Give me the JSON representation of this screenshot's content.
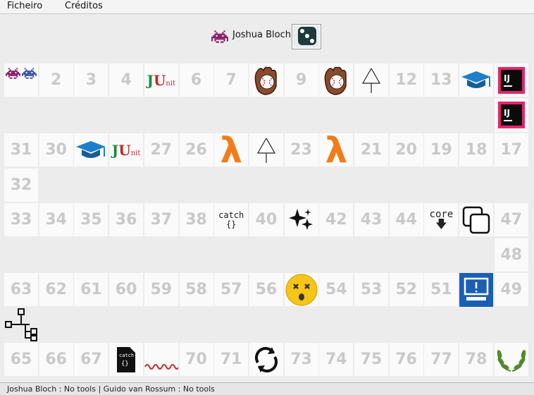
{
  "menu": {
    "file": "Ficheiro",
    "credits": "Créditos"
  },
  "player": {
    "name": "Joshua Bloch",
    "icon": "space-invader-icon",
    "die_icon": "die-icon"
  },
  "status": "Joshua Bloch : No tools | Guido van Rossum : No tools",
  "colors": {
    "invader": "#8b1f6a",
    "lambda": "#f27c17",
    "monitor": "#1a5fb4",
    "emoji": "#f5c518",
    "laurel": "#4f8a2a",
    "wave": "#cc2a2a"
  },
  "cells": [
    {
      "id": "c1",
      "label": "",
      "icon": "two-invaders-icon"
    },
    {
      "id": "c2",
      "label": "2"
    },
    {
      "id": "c3",
      "label": "3"
    },
    {
      "id": "c4",
      "label": "4"
    },
    {
      "id": "c5",
      "label": "",
      "icon": "junit-icon",
      "text": "JU",
      "sub": "nit"
    },
    {
      "id": "c6",
      "label": "6"
    },
    {
      "id": "c7",
      "label": "7"
    },
    {
      "id": "c8",
      "label": "",
      "icon": "baseball-glove-icon"
    },
    {
      "id": "c9",
      "label": "9"
    },
    {
      "id": "c10",
      "label": "",
      "icon": "baseball-glove-icon"
    },
    {
      "id": "c11",
      "label": "",
      "icon": "arrow-up-icon"
    },
    {
      "id": "c12",
      "label": "12"
    },
    {
      "id": "c13",
      "label": "13"
    },
    {
      "id": "c14",
      "label": "",
      "icon": "graduation-cap-icon"
    },
    {
      "id": "c15",
      "label": "",
      "icon": "intellij-icon",
      "text": "IJ"
    },
    {
      "id": "c16",
      "label": "",
      "icon": "intellij-icon",
      "text": "IJ"
    },
    {
      "id": "c17",
      "label": "17"
    },
    {
      "id": "c18",
      "label": "18"
    },
    {
      "id": "c19",
      "label": "19"
    },
    {
      "id": "c20",
      "label": "20"
    },
    {
      "id": "c21",
      "label": "21"
    },
    {
      "id": "c22",
      "label": "",
      "icon": "lambda-icon",
      "text": "λ"
    },
    {
      "id": "c23",
      "label": "23"
    },
    {
      "id": "c24",
      "label": "",
      "icon": "arrow-up-icon"
    },
    {
      "id": "c25",
      "label": "",
      "icon": "lambda-icon",
      "text": "λ"
    },
    {
      "id": "c26",
      "label": "26"
    },
    {
      "id": "c27",
      "label": "27"
    },
    {
      "id": "c28",
      "label": "",
      "icon": "junit-icon",
      "text": "JU",
      "sub": "nit"
    },
    {
      "id": "c29",
      "label": "",
      "icon": "graduation-cap-icon"
    },
    {
      "id": "c30",
      "label": "30"
    },
    {
      "id": "c31",
      "label": "31"
    },
    {
      "id": "c32",
      "label": "32"
    },
    {
      "id": "c33",
      "label": "33"
    },
    {
      "id": "c34",
      "label": "34"
    },
    {
      "id": "c35",
      "label": "35"
    },
    {
      "id": "c36",
      "label": "36"
    },
    {
      "id": "c37",
      "label": "37"
    },
    {
      "id": "c38",
      "label": "38"
    },
    {
      "id": "c39",
      "label": "",
      "icon": "catch-icon",
      "text": "catch",
      "sub": "{}"
    },
    {
      "id": "c40",
      "label": "40"
    },
    {
      "id": "c41",
      "label": "",
      "icon": "sparkles-icon"
    },
    {
      "id": "c42",
      "label": "42"
    },
    {
      "id": "c43",
      "label": "43"
    },
    {
      "id": "c44",
      "label": "44"
    },
    {
      "id": "c45",
      "label": "",
      "icon": "core-down-icon",
      "text": "core"
    },
    {
      "id": "c46",
      "label": "",
      "icon": "copy-icon"
    },
    {
      "id": "c47",
      "label": "47"
    },
    {
      "id": "c48",
      "label": "48"
    },
    {
      "id": "c49",
      "label": "49"
    },
    {
      "id": "c50",
      "label": "",
      "icon": "monitor-alert-icon"
    },
    {
      "id": "c51",
      "label": "51"
    },
    {
      "id": "c52",
      "label": "52"
    },
    {
      "id": "c53",
      "label": "53"
    },
    {
      "id": "c54",
      "label": "54"
    },
    {
      "id": "c55",
      "label": "",
      "icon": "dizzy-face-icon"
    },
    {
      "id": "c56",
      "label": "56"
    },
    {
      "id": "c57",
      "label": "57"
    },
    {
      "id": "c58",
      "label": "58"
    },
    {
      "id": "c59",
      "label": "59"
    },
    {
      "id": "c60",
      "label": "60"
    },
    {
      "id": "c61",
      "label": "61"
    },
    {
      "id": "c62",
      "label": "62"
    },
    {
      "id": "c63",
      "label": "63"
    },
    {
      "id": "c64",
      "label": "",
      "icon": "tree-diagram-icon"
    },
    {
      "id": "c65",
      "label": "65"
    },
    {
      "id": "c66",
      "label": "66"
    },
    {
      "id": "c67",
      "label": "67"
    },
    {
      "id": "c68",
      "label": "",
      "icon": "catch-file-icon",
      "text": "catch",
      "sub": "{}"
    },
    {
      "id": "c69",
      "label": "",
      "icon": "wavy-line-icon"
    },
    {
      "id": "c70",
      "label": "70"
    },
    {
      "id": "c71",
      "label": "71"
    },
    {
      "id": "c72",
      "label": "",
      "icon": "refresh-arrows-icon"
    },
    {
      "id": "c73",
      "label": "73"
    },
    {
      "id": "c74",
      "label": "74"
    },
    {
      "id": "c75",
      "label": "75"
    },
    {
      "id": "c76",
      "label": "76"
    },
    {
      "id": "c77",
      "label": "77"
    },
    {
      "id": "c78",
      "label": "78"
    },
    {
      "id": "c79",
      "label": "",
      "icon": "laurel-wreath-icon"
    }
  ]
}
